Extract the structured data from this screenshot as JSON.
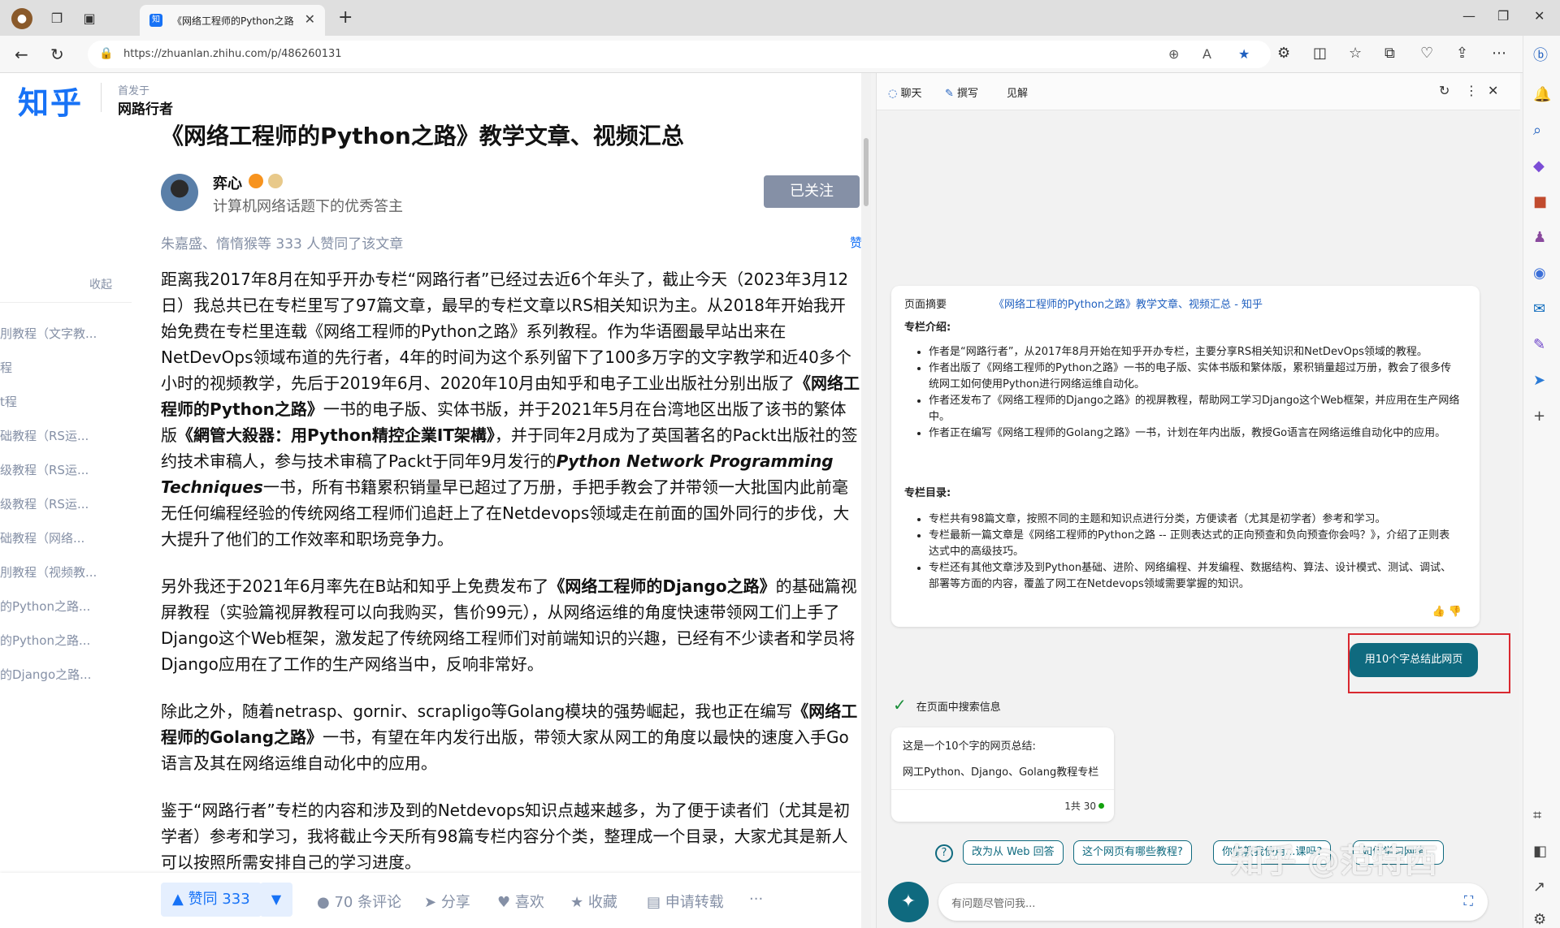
{
  "browser": {
    "tab_title": "《网络工程师的Python之路》",
    "tab_favicon": "知",
    "url": "https://zhuanlan.zhihu.com/p/486260131"
  },
  "article": {
    "logo": "知乎",
    "published_in_label": "首发于",
    "column_name": "网路行者",
    "title": "《网络工程师的Python之路》教学文章、视频汇总",
    "author_name": "弈心",
    "author_bio": "计算机网络话题下的优秀答主",
    "follow_label": "已关注",
    "likers": "朱嘉盛、惰惰猴等 333 人赞同了该文章",
    "side_like": "赞",
    "toc_collapse": "收起",
    "toc_items": [
      "刖教程（文字教...",
      "程",
      "t程",
      "础教程（RS运...",
      "级教程（RS运...",
      "级教程（RS运...",
      "础教程（网络...",
      "刖教程（视频教...",
      "的Python之路...",
      "的Python之路...",
      "的Django之路..."
    ],
    "para1": "距离我2017年8月在知乎开办专栏“网路行者”已经过去近6个年头了，截止今天（2023年3月12日）我总共已在专栏里写了97篇文章，最早的专栏文章以RS相关知识为主。从2018年开始我开始免费在专栏里连载《网络工程师的Python之路》系列教程。作为华语圈最早站出来在NetDevOps领域布道的先行者，4年的时间为这个系列留下了100多万字的文字教学和近40多个小时的视频教学，先后于2019年6月、2020年10月由知乎和电子工业出版社分别出版了",
    "para1_b1": "《网络工程师的Python之路》",
    "para1_m": "一书的电子版、实体书版，并于2021年5月在台湾地区出版了该书的繁体版",
    "para1_b2": "《網管大殺器：用Python精控企業IT架構》",
    "para1_m2": "，并于同年2月成为了英国著名的Packt出版社的签约技术审稿人，参与技术审稿了Packt于同年9月发行的",
    "para1_i": "Python Network Programming Techniques",
    "para1_end": "一书，所有书籍累积销量早已超过了万册，手把手教会了并带领一大批国内此前毫无任何编程经验的传统网络工程师们追赶上了在Netdevops领域走在前面的国外同行的步伐，大大提升了他们的工作效率和职场竞争力。",
    "para2_a": "另外我还于2021年6月率先在B站和知乎上免费发布了",
    "para2_b": "《网络工程师的Django之路》",
    "para2_c": "的基础篇视屏教程（实验篇视屏教程可以向我购买，售价99元），从网络运维的角度快速带领网工们上手了Django这个Web框架，激发起了传统网络工程师们对前端知识的兴趣，已经有不少读者和学员将Django应用在了工作的生产网络当中，反响非常好。",
    "para3_a": "除此之外，随着netrasp、gornir、scrapligo等Golang模块的强势崛起，我也正在编写",
    "para3_b": "《网络工程师的Golang之路》",
    "para3_c": "一书，有望在年内发行出版，带领大家从网工的角度以最快的速度入手Go语言及其在网络运维自动化中的应用。",
    "para4": "鉴于“网路行者”专栏的内容和涉及到的Netdevops知识点越来越多，为了便于读者们（尤其是初学者）参考和学习，我将截止今天所有98篇专栏内容分个类，整理成一个目录，大家尤其是新人可以按照所需安排自己的学习进度。",
    "actions": {
      "vote_up": "▲ 赞同 333",
      "vote_down": "▼",
      "comments": "70 条评论",
      "share": "分享",
      "like": "喜欢",
      "collect": "收藏",
      "repost": "申请转载",
      "more": "···"
    }
  },
  "copilot": {
    "tabs": [
      "聊天",
      "撰写",
      "见解"
    ],
    "summary_label": "页面摘要",
    "summary_link": "《网络工程师的Python之路》教学文章、视频汇总 - 知乎",
    "intro_heading": "专栏介绍:",
    "intro_items": [
      "作者是“网路行者”，从2017年8月开始在知乎开办专栏，主要分享RS相关知识和NetDevOps领域的教程。",
      "作者出版了《网络工程师的Python之路》一书的电子版、实体书版和繁体版，累积销量超过万册，教会了很多传统网工如何使用Python进行网络运维自动化。",
      "作者还发布了《网络工程师的Django之路》的视屏教程，帮助网工学习Django这个Web框架，并应用在生产网络中。",
      "作者正在编写《网络工程师的Golang之路》一书，计划在年内出版，教授Go语言在网络运维自动化中的应用。"
    ],
    "toc_heading": "专栏目录:",
    "toc_items": [
      "专栏共有98篇文章，按照不同的主题和知识点进行分类，方便读者（尤其是初学者）参考和学习。",
      "专栏最新一篇文章是《网络工程师的Python之路 -- 正则表达式的正向预查和负向预查你会吗？》，介绍了正则表达式中的高级技巧。",
      "专栏还有其他文章涉及到Python基础、进阶、网络编程、并发编程、数据结构、算法、设计模式、测试、调试、部署等方面的内容，覆盖了网工在Netdevops领域需要掌握的知识。"
    ],
    "thumbs": "👍 👎",
    "user_prompt": "用10个字总结此网页",
    "search_status": "在页面中搜索信息",
    "answer_line1": "这是一个10个字的网页总结:",
    "answer_line2": "网工Python、Django、Golang教程专栏",
    "answer_count": "1共 30",
    "suggestions": [
      "改为从 Web 回答",
      "这个网页有哪些教程?",
      "你能教我使用...课吗?",
      "如何学习网络..."
    ],
    "input_placeholder": "有问题尽管问我...",
    "watermark": "知乎 @范特西"
  }
}
